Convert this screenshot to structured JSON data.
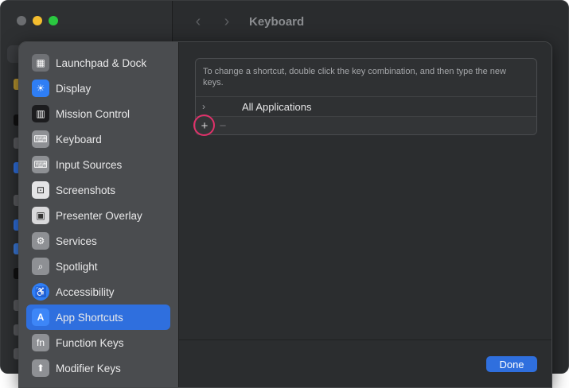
{
  "window": {
    "title": "Keyboard",
    "back_glyph": "‹",
    "forward_glyph": "›"
  },
  "sidebar": {
    "items": [
      {
        "label": "Launchpad & Dock",
        "icon": "launchpad-icon",
        "glyph": "▦",
        "color": "#6f7175"
      },
      {
        "label": "Display",
        "icon": "display-icon",
        "glyph": "☀",
        "color": "#2f7ef5"
      },
      {
        "label": "Mission Control",
        "icon": "mission-control-icon",
        "glyph": "▥",
        "color": "#1c1c1e"
      },
      {
        "label": "Keyboard",
        "icon": "keyboard-icon",
        "glyph": "⌨",
        "color": "#8e9094"
      },
      {
        "label": "Input Sources",
        "icon": "input-sources-icon",
        "glyph": "⌨",
        "color": "#8e9094"
      },
      {
        "label": "Screenshots",
        "icon": "screenshots-icon",
        "glyph": "⊡",
        "color": "#e4e4e6"
      },
      {
        "label": "Presenter Overlay",
        "icon": "presenter-overlay-icon",
        "glyph": "▣",
        "color": "#d9d9db"
      },
      {
        "label": "Services",
        "icon": "services-icon",
        "glyph": "⚙",
        "color": "#8e9094"
      },
      {
        "label": "Spotlight",
        "icon": "spotlight-icon",
        "glyph": "⌕",
        "color": "#8e9094"
      },
      {
        "label": "Accessibility",
        "icon": "accessibility-icon",
        "glyph": "♿",
        "color": "#2f7ef5"
      },
      {
        "label": "App Shortcuts",
        "icon": "app-shortcuts-icon",
        "glyph": "A",
        "color": "#2f7ef5",
        "selected": true
      },
      {
        "label": "Function Keys",
        "icon": "function-keys-icon",
        "glyph": "fn",
        "color": "#8e9094"
      },
      {
        "label": "Modifier Keys",
        "icon": "modifier-keys-icon",
        "glyph": "⬆",
        "color": "#8e9094"
      }
    ]
  },
  "main": {
    "description": "To change a shortcut, double click the key combination, and then type the new keys.",
    "row": {
      "chevron": "›",
      "label": "All Applications"
    },
    "toolbar": {
      "add": "+",
      "remove": "−"
    },
    "done_label": "Done"
  },
  "colors": {
    "accent": "#2f6fde",
    "highlight_ring": "#e0316a"
  }
}
